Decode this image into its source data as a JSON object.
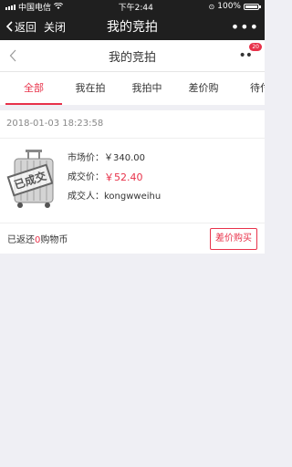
{
  "status_bar": {
    "carrier": "中国电信",
    "time": "下午2:44",
    "battery": "100%"
  },
  "wechat_bar": {
    "back_label": "返回",
    "close_label": "关闭",
    "title": "我的竞拍",
    "more_label": "•••"
  },
  "page_header": {
    "title": "我的竞拍",
    "more_label": "••",
    "badge": "20"
  },
  "tabs": [
    {
      "label": "全部",
      "active": true
    },
    {
      "label": "我在拍",
      "active": false
    },
    {
      "label": "我拍中",
      "active": false
    },
    {
      "label": "差价购",
      "active": false
    },
    {
      "label": "待付",
      "active": false
    }
  ],
  "order": {
    "timestamp": "2018-01-03 18:23:58",
    "stamp_text": "已成交",
    "market_price_label": "市场价：",
    "market_price": "￥340.00",
    "deal_price_label": "成交价：",
    "deal_price": "￥52.40",
    "buyer_label": "成交人：",
    "buyer": "kongwweihu",
    "returned_prefix": "已返还",
    "returned_amount": "0",
    "returned_suffix": "购物币",
    "buy_button": "差价购买"
  },
  "colors": {
    "accent": "#e8324a",
    "topbar": "#1f1f1f",
    "background": "#efeff4"
  }
}
